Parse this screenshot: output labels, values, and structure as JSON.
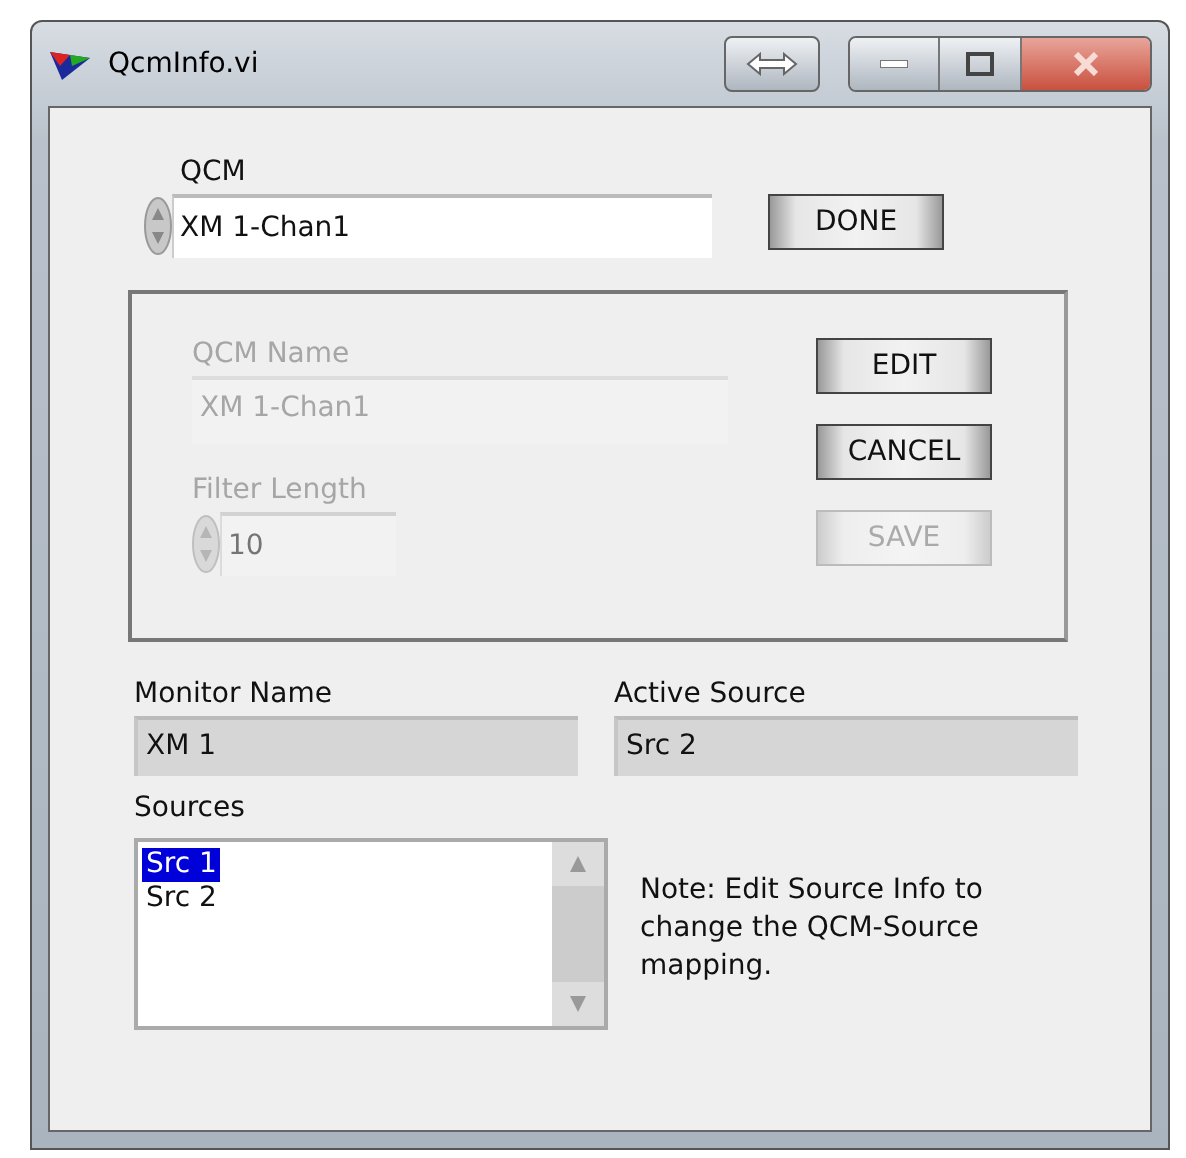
{
  "window": {
    "title": "QcmInfo.vi"
  },
  "qcm": {
    "label": "QCM",
    "value": "XM 1-Chan1"
  },
  "done_button": {
    "label": "DONE"
  },
  "edit_group": {
    "name_field": {
      "label": "QCM Name",
      "value": "XM 1-Chan1",
      "disabled": true
    },
    "filter_length": {
      "label": "Filter Length",
      "value": "10",
      "disabled": true
    },
    "buttons": [
      {
        "label": "EDIT",
        "disabled": false
      },
      {
        "label": "CANCEL",
        "disabled": false
      },
      {
        "label": "SAVE",
        "disabled": true
      }
    ]
  },
  "monitor_name": {
    "label": "Monitor Name",
    "value": "XM 1"
  },
  "active_source": {
    "label": "Active Source",
    "value": "Src 2"
  },
  "sources": {
    "label": "Sources",
    "items": [
      {
        "label": "Src 1",
        "selected": true
      },
      {
        "label": "Src 2",
        "selected": false
      }
    ]
  },
  "note": "Note: Edit Source Info to change the QCM-Source mapping."
}
